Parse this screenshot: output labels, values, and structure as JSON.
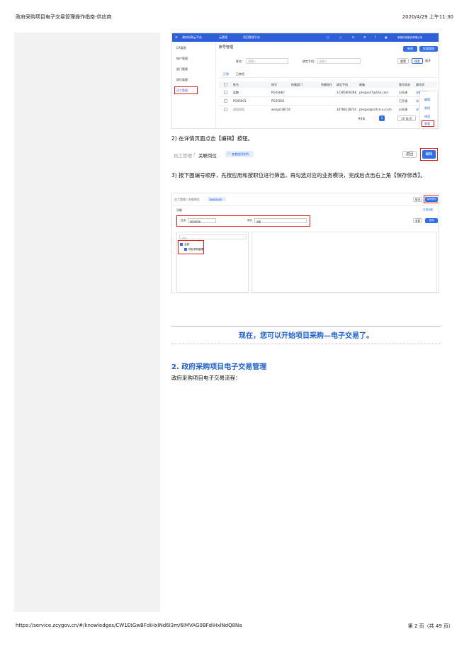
{
  "header": {
    "title": "政府采购项目电子交易管理操作指南-供应商",
    "datetime": "2020/4/29 上午11:30"
  },
  "shot1": {
    "platform": "政府采购云平台",
    "nav": [
      "云管理",
      "项目管理平台"
    ],
    "corp": "某某科技股份有限公司",
    "side_items": [
      "CA管理",
      "账户管理",
      "部门管理",
      "岗位管理",
      "员工管理"
    ],
    "page_title": "账号管理",
    "top_buttons": [
      "新增",
      "批量管理"
    ],
    "filter_name_label": "姓名：",
    "filter_name_ph": "请输入",
    "filter_phone_label": "绑定手机：",
    "filter_phone_ph": "请输入",
    "filter_buttons": [
      "重置",
      "搜索",
      "展开"
    ],
    "tabs": [
      "正常",
      "已禁用"
    ],
    "columns": [
      "姓名",
      "账号",
      "所属部门",
      "所属岗位",
      "绑定手机",
      "邮箱",
      "账号状态",
      "操作项"
    ],
    "rows": [
      {
        "name": "梁鹏",
        "account": "PGXSH67",
        "phone": "17365800288",
        "email": "pengxs47@163.com",
        "status": "已开通",
        "op": "详情 更多"
      },
      {
        "name": "PGXS001",
        "account": "PGXS001",
        "phone": "",
        "email": "",
        "status": "已开通",
        "op": "详"
      },
      {
        "name": "",
        "account": "wangcl38734",
        "phone": "18768128734",
        "email": "pengxs@zcitce-ru.com",
        "status": "已开通",
        "op": "详"
      }
    ],
    "dropdown_items": [
      "编辑",
      "禁用",
      "停用",
      "查看"
    ],
    "pager_total": "共4条",
    "pager_page": "1",
    "pager_size": "10 条/页"
  },
  "step2": "2) 在详情页面点击【编辑】按钮。",
  "shot2": {
    "breadcrumb_root": "员工管理",
    "breadcrumb_sep": "/",
    "breadcrumb_current": "关联岗位",
    "badge": "查看使用说明",
    "back_label": "返回",
    "edit_label": "编辑"
  },
  "step3": "3) 按下图编号顺序，先按应用和按职位进行筛选，再勾选对应的业务模块，完成后点击右上角【保存修改】。",
  "shot3": {
    "breadcrumb": "员工管理 / 关联岗位",
    "badge": "查看使用说明",
    "back_label": "取消",
    "save_label": "保存修改",
    "section": "功能",
    "section_link": "已选功能",
    "app_label": "应用",
    "app_value": "供应商应用",
    "pos_label": "岗位",
    "pos_value": "全部",
    "reset_label": "重置",
    "query_label": "查询",
    "search_ph": "请输入",
    "tree_root": "全部",
    "tree_child": "项目采购管理"
  },
  "banner": "现在，您可以开始项目采购—电子交易了。",
  "section2": {
    "heading": "2. 政府采购项目电子交易管理",
    "desc": "政府采购项目电子交易流程："
  },
  "footer": {
    "url": "https://service.zcygov.cn/#/knowledges/CW1EtGwBFdiHxlNd6I3m/6IMVAG0BFdiHxlNdQ8Na",
    "page": "第 2 页（共 49 页）"
  },
  "colors": {
    "accent": "#2f6ee6",
    "highlight": "#e02020",
    "heading": "#1d5fd6"
  }
}
